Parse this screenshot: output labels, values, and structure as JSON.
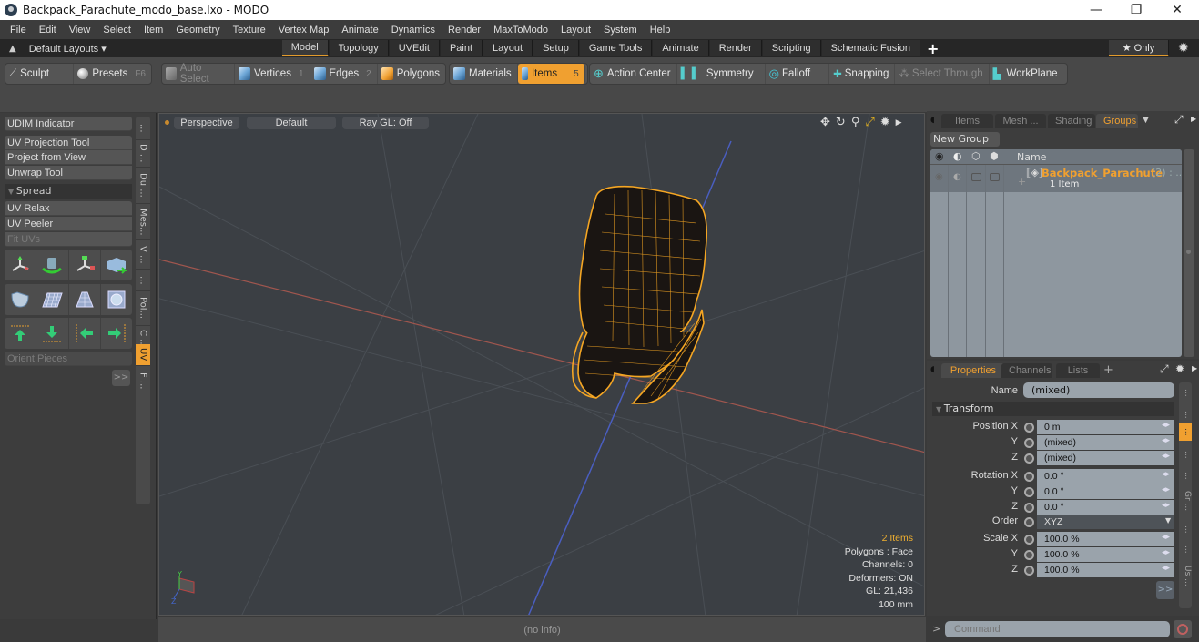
{
  "window": {
    "title": "Backpack_Parachute_modo_base.lxo - MODO",
    "minimize": "—",
    "restore": "❐",
    "close": "✕"
  },
  "menu": [
    "File",
    "Edit",
    "View",
    "Select",
    "Item",
    "Geometry",
    "Texture",
    "Vertex Map",
    "Animate",
    "Dynamics",
    "Render",
    "MaxToModo",
    "Layout",
    "System",
    "Help"
  ],
  "layouts": {
    "dropdown": "Default Layouts ▾",
    "tabs": [
      "Model",
      "Topology",
      "UVEdit",
      "Paint",
      "Layout",
      "Setup",
      "Game Tools",
      "Animate",
      "Render",
      "Scripting",
      "Schematic Fusion"
    ],
    "active": "Model",
    "add": "+",
    "only_label": "★ Only"
  },
  "toolbar": {
    "sculpt": "Sculpt",
    "presets": "Presets",
    "presets_key": "F6",
    "auto_select": "Auto Select",
    "vertices": "Vertices",
    "vertices_key": "1",
    "edges": "Edges",
    "edges_key": "2",
    "polygons": "Polygons",
    "materials": "Materials",
    "items": "Items",
    "items_key": "5",
    "action_center": "Action Center",
    "symmetry": "Symmetry",
    "falloff": "Falloff",
    "snapping": "Snapping",
    "select_through": "Select Through",
    "workplane": "WorkPlane"
  },
  "leftpanel": {
    "udim": "UDIM Indicator",
    "uv_projection": "UV Projection Tool",
    "project_from_view": "Project from View",
    "unwrap": "Unwrap Tool",
    "spread": "Spread",
    "uv_relax": "UV Relax",
    "uv_peeler": "UV Peeler",
    "fit_uvs": "Fit UVs",
    "orient_pieces": "Orient Pieces",
    "more": ">>",
    "vtabs": [
      "...",
      "D ...",
      "Du ...",
      "Mes...",
      "V ...",
      "...",
      "Pol...",
      "C ...",
      "UV",
      "F ..."
    ],
    "active_vtab": "UV"
  },
  "viewport": {
    "view": "Perspective",
    "shading": "Default",
    "raygl": "Ray GL: Off",
    "stats": {
      "items": "2 Items",
      "polygons": "Polygons : Face",
      "channels": "Channels: 0",
      "deformers": "Deformers: ON",
      "gl": "GL: 21,436",
      "scale": "100 mm"
    },
    "axis_y": "Y",
    "axis_z": "Z"
  },
  "status": "(no info)",
  "groups_panel": {
    "tabs": [
      "Items",
      "Mesh ...",
      "Shading",
      "Groups"
    ],
    "active": "Groups",
    "new_group": "New Group",
    "col_name": "Name",
    "group_name": "Backpack_Parachute",
    "group_count": "(2) : ...",
    "group_sub": "1 Item"
  },
  "properties": {
    "tabs": [
      "Properties",
      "Channels",
      "Lists"
    ],
    "active": "Properties",
    "add": "+",
    "name_label": "Name",
    "name_value": "(mixed)",
    "transform": "Transform",
    "rows": [
      {
        "label": "Position X",
        "value": "0 m"
      },
      {
        "label": "Y",
        "value": "(mixed)"
      },
      {
        "label": "Z",
        "value": "(mixed)"
      },
      {
        "label": "Rotation X",
        "value": "0.0 °"
      },
      {
        "label": "Y",
        "value": "0.0 °"
      },
      {
        "label": "Z",
        "value": "0.0 °"
      },
      {
        "label": "Order",
        "value": "XYZ"
      },
      {
        "label": "Scale X",
        "value": "100.0 %"
      },
      {
        "label": "Y",
        "value": "100.0 %"
      },
      {
        "label": "Z",
        "value": "100.0 %"
      }
    ],
    "more": ">>",
    "vtabs": [
      "...",
      "...",
      "...",
      "...",
      "...",
      "Gr ...",
      "...",
      "...",
      "Us ..."
    ]
  },
  "command": {
    "prompt": ">",
    "placeholder": "Command"
  },
  "colors": {
    "accent": "#f0a030",
    "wire": "#f5a623"
  }
}
